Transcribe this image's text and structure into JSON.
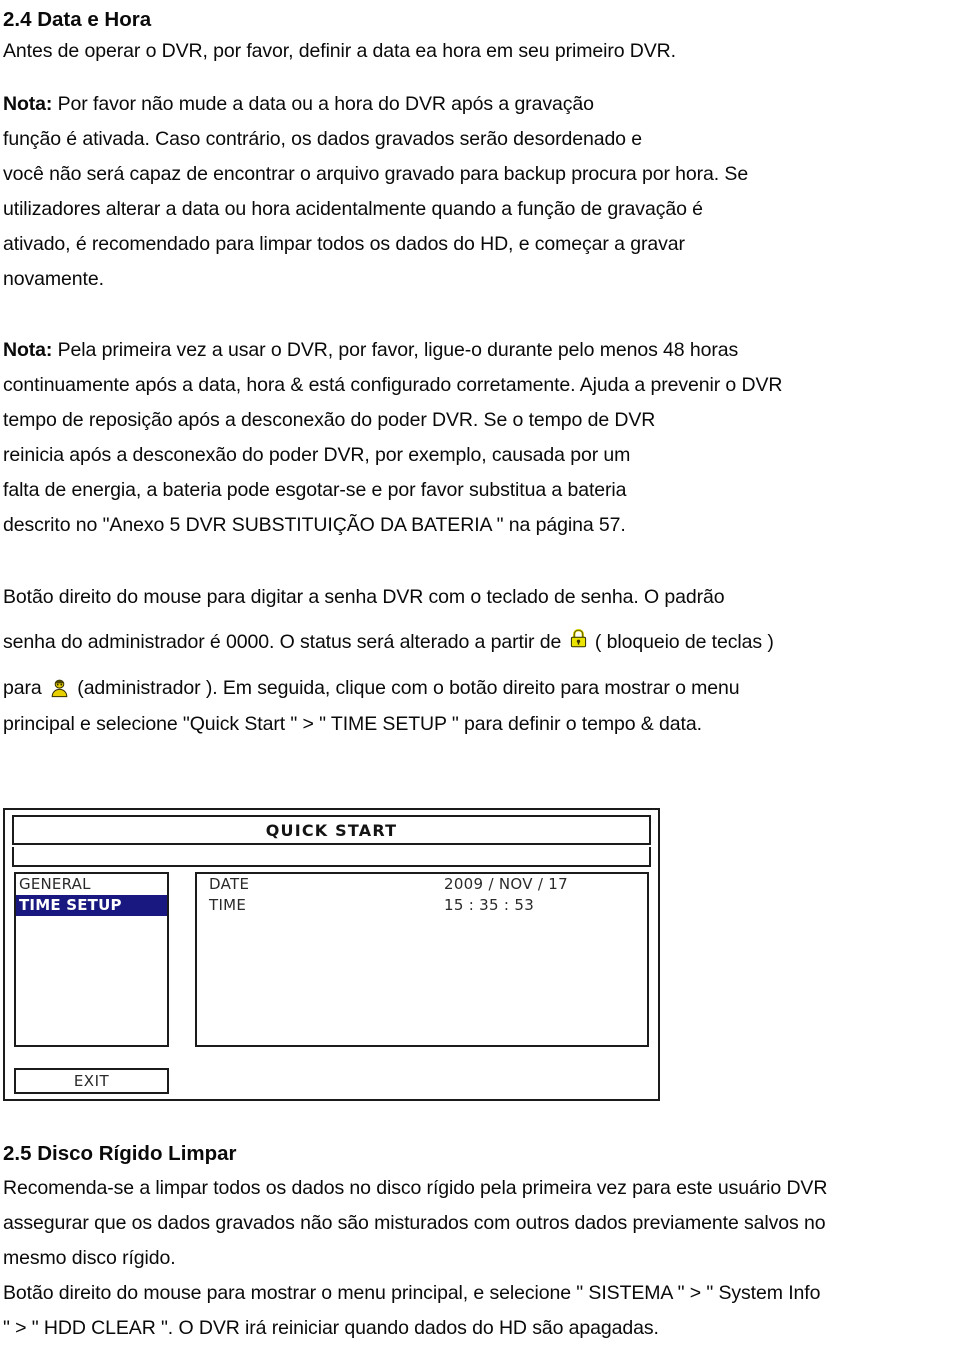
{
  "document": {
    "section_2_4": {
      "heading": "2.4 Data e Hora",
      "lines": [
        "Antes de operar o DVR, por favor, definir a data ea hora em seu primeiro DVR.",
        "Nota: Por favor não mude a data ou a hora do DVR após a gravação",
        "função é ativada.  Caso contrário, os dados gravados serão desordenado e",
        "você não será capaz de encontrar o arquivo gravado para backup procura por hora.  Se",
        "utilizadores alterar a data ou hora acidentalmente quando a função de gravação é",
        "ativado, é recomendado para limpar todos os dados do HD, e começar a gravar",
        "novamente.",
        "Nota: Pela primeira vez a usar o DVR, por favor, ligue-o durante pelo menos 48 horas",
        "continuamente após a data, hora & está configurado corretamente.  Ajuda a prevenir o DVR",
        "tempo de reposição após a desconexão do poder DVR.  Se o tempo de DVR",
        "reinicia após a desconexão do poder DVR, por exemplo, causada por um",
        "falta de energia, a bateria pode esgotar-se e por favor substitua a bateria",
        "descrito no \"Anexo 5 DVR SUBSTITUIÇÃO DA BATERIA \" na página 57.",
        "Botão direito do mouse para digitar a senha DVR com o teclado de senha.  O padrão"
      ],
      "nota1_label": "Nota:",
      "nota1_rest": " Por favor não mude a data ou a hora do DVR após a gravação",
      "nota2_label": "Nota:",
      "nota2_rest": " Pela primeira vez a usar o DVR, por favor, ligue-o durante pelo menos 48 horas",
      "password_line_a": "senha do administrador é 0000.  O status será alterado a partir de",
      "password_line_b": "( bloqueio de teclas )",
      "admin_line_a": "para",
      "admin_line_b": "(administrador ).  Em seguida, clique com o botão direito para mostrar o menu",
      "final_line": "principal e selecione \"Quick Start \" > \" TIME SETUP \" para definir o tempo & data."
    },
    "section_2_5": {
      "heading": "2.5 Disco Rígido Limpar",
      "lines": [
        "Recomenda-se a limpar todos os dados no disco rígido pela primeira vez para este usuário DVR",
        "assegurar que os dados gravados não são misturados com outros dados previamente salvos no",
        "mesmo disco rígido.",
        "Botão direito do mouse para mostrar o menu principal, e selecione \" SISTEMA \" > \" System Info",
        "\" > \" HDD CLEAR \".  O DVR irá reiniciar quando dados do HD são apagadas."
      ]
    }
  },
  "dvr_screenshot": {
    "title": "QUICK START",
    "menu_items": [
      {
        "label": "GENERAL",
        "selected": false
      },
      {
        "label": "TIME SETUP",
        "selected": true
      }
    ],
    "fields": [
      {
        "key": "DATE",
        "value": "2009 / NOV / 17"
      },
      {
        "key": "TIME",
        "value": "15 : 35 : 53"
      }
    ],
    "exit_label": "EXIT",
    "colors": {
      "selected_bg": "#181880",
      "selected_fg": "#ffffff",
      "border": "#1b1b1b"
    }
  },
  "icons": {
    "lock": {
      "name": "lock-icon",
      "color": "#e8e000"
    },
    "admin": {
      "name": "administrator-icon",
      "color": "#e8d000"
    }
  }
}
